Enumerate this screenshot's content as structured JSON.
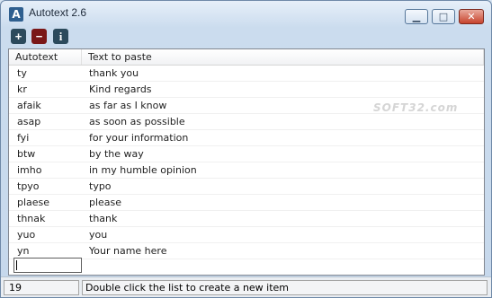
{
  "window": {
    "title": "Autotext 2.6"
  },
  "toolbar": {
    "add_label": "+",
    "remove_label": "−",
    "info_label": "i"
  },
  "columns": [
    "Autotext",
    "Text to paste"
  ],
  "rows": [
    {
      "autotext": "ty",
      "paste": "thank you"
    },
    {
      "autotext": "kr",
      "paste": "Kind regards"
    },
    {
      "autotext": "afaik",
      "paste": "as far as I know"
    },
    {
      "autotext": "asap",
      "paste": "as soon as possible"
    },
    {
      "autotext": "fyi",
      "paste": "for your information"
    },
    {
      "autotext": "btw",
      "paste": "by the way"
    },
    {
      "autotext": "imho",
      "paste": "in my humble opinion"
    },
    {
      "autotext": "tpyo",
      "paste": "typo"
    },
    {
      "autotext": "plaese",
      "paste": "please"
    },
    {
      "autotext": "thnak",
      "paste": "thank"
    },
    {
      "autotext": "yuo",
      "paste": "you"
    },
    {
      "autotext": "yn",
      "paste": "Your name here"
    }
  ],
  "edit_value": "",
  "watermark": "SOFT32.com",
  "status": {
    "count": "19",
    "hint": "Double click the list to create a new item"
  }
}
